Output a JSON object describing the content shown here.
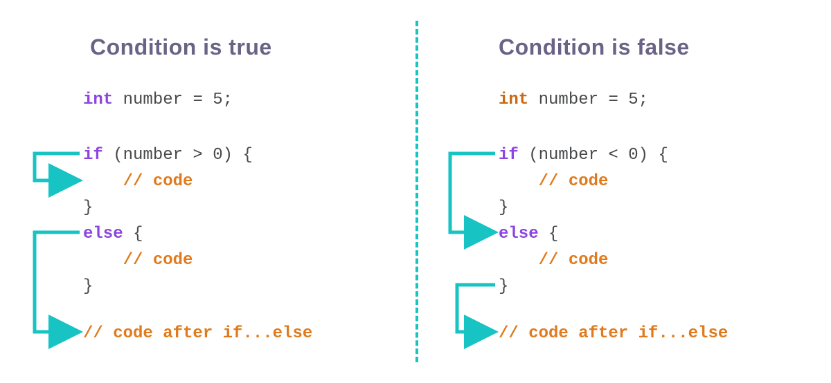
{
  "colors": {
    "heading": "#6b6385",
    "arrow": "#17c3c3",
    "keyword_purple": "#8e44e0",
    "keyword_orange": "#c76a12",
    "comment": "#e07a1c",
    "text": "#47484a"
  },
  "left": {
    "title": "Condition is true",
    "decl_kw": "int",
    "decl_rest": " number = 5;",
    "if_kw": "if",
    "if_cond": " (number > 0) {",
    "if_body": "    // code",
    "if_close": "}",
    "else_kw": "else",
    "else_open": " {",
    "else_body": "    // code",
    "else_close": "}",
    "after": "// code after if...else"
  },
  "right": {
    "title": "Condition is false",
    "decl_kw": "int",
    "decl_rest": " number = 5;",
    "if_kw": "if",
    "if_cond": " (number < 0) {",
    "if_body": "    // code",
    "if_close": "}",
    "else_kw": "else",
    "else_open": " {",
    "else_body": "    // code",
    "else_close": "}",
    "after": "// code after if...else"
  }
}
